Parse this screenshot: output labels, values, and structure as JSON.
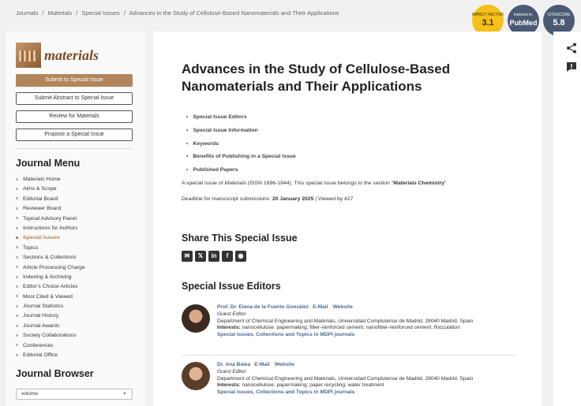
{
  "breadcrumb": [
    "Journals",
    "/",
    "Materials",
    "/",
    "Special Issues",
    "/",
    "Advances in the Study of Cellulose-Based Nanomaterials and Their Applications"
  ],
  "badges": {
    "impact": {
      "label": "IMPACT FACTOR",
      "value": "3.1"
    },
    "indexed": {
      "label": "Indexed in:",
      "value": "PubMed"
    },
    "citescore": {
      "label": "CITESCORE",
      "value": "5.8"
    }
  },
  "sidebar": {
    "logo_text": "materials",
    "buttons": [
      "Submit to Special Issue",
      "Submit Abstract to Special Issue",
      "Review for Materials",
      "Propose a Special Issue"
    ],
    "journal_menu_title": "Journal Menu",
    "menu": [
      "Materials Home",
      "Aims & Scope",
      "Editorial Board",
      "Reviewer Board",
      "Topical Advisory Panel",
      "Instructions for Authors",
      "Special Issues",
      "Topics",
      "Sections & Collections",
      "Article Processing Charge",
      "Indexing & Archiving",
      "Editor’s Choice Articles",
      "Most Cited & Viewed",
      "Journal Statistics",
      "Journal History",
      "Journal Awards",
      "Society Collaborations",
      "Conferences",
      "Editorial Office"
    ],
    "active_item": "Special Issues",
    "journal_browser_title": "Journal Browser",
    "volume_select": "volume"
  },
  "main": {
    "title_line1": "Advances in the Study of Cellulose-Based",
    "title_line2": "Nanomaterials and Their Applications",
    "toc": [
      "Special Issue Editors",
      "Special Issue Information",
      "Keywords",
      "Benefits of Publishing in a Special Issue",
      "Published Papers"
    ],
    "desc_pre": "A special issue of ",
    "desc_journal": "Materials",
    "desc_issn": " (ISSN 1996-1944). This special issue belongs to the section \"",
    "desc_section": "Materials Chemistry",
    "desc_post": "\".",
    "deadline_label": "Deadline for manuscript submissions: ",
    "deadline_date": "20 January 2025",
    "deadline_views": " | Viewed by 427",
    "share_title": "Share This Special Issue",
    "editors_title": "Special Issue Editors",
    "editors": [
      {
        "name": "Prof. Dr. Elena de la Fuente González",
        "email": "E-Mail",
        "website": "Website",
        "role": "Guest Editor",
        "dept": "Department of Chemical Engineering and Materials, Universidad Complutense de Madrid, 28040 Madrid, Spain",
        "interests_label": "Interests:",
        "interests": " nanocellulose; papermaking; fiber-reinforced cement; nanofiber-reinforced cement; flocculation",
        "links": "Special Issues, Collections and Topics in MDPI journals"
      },
      {
        "name": "Dr. Ana Balea",
        "email": "E-Mail",
        "website": "Website",
        "role": "Guest Editor",
        "dept": "Department of Chemical Engineering and Materials, Universidad Complutense de Madrid, 28040 Madrid, Spain",
        "interests_label": "Interests:",
        "interests": " nanocellulose; papermaking; paper recycling; water treatment",
        "links": "Special Issues, Collections and Topics in MDPI journals"
      }
    ]
  },
  "icons": {
    "share_icons": [
      "email-icon",
      "x-icon",
      "linkedin-icon",
      "facebook-icon",
      "wechat-icon"
    ],
    "right_icons": [
      "share-icon",
      "feedback-icon"
    ]
  },
  "colors": {
    "accent": "#b2865c",
    "link": "#4b6a8f",
    "impact": "#f5c01a",
    "badge_dark": "#4b5a73"
  }
}
